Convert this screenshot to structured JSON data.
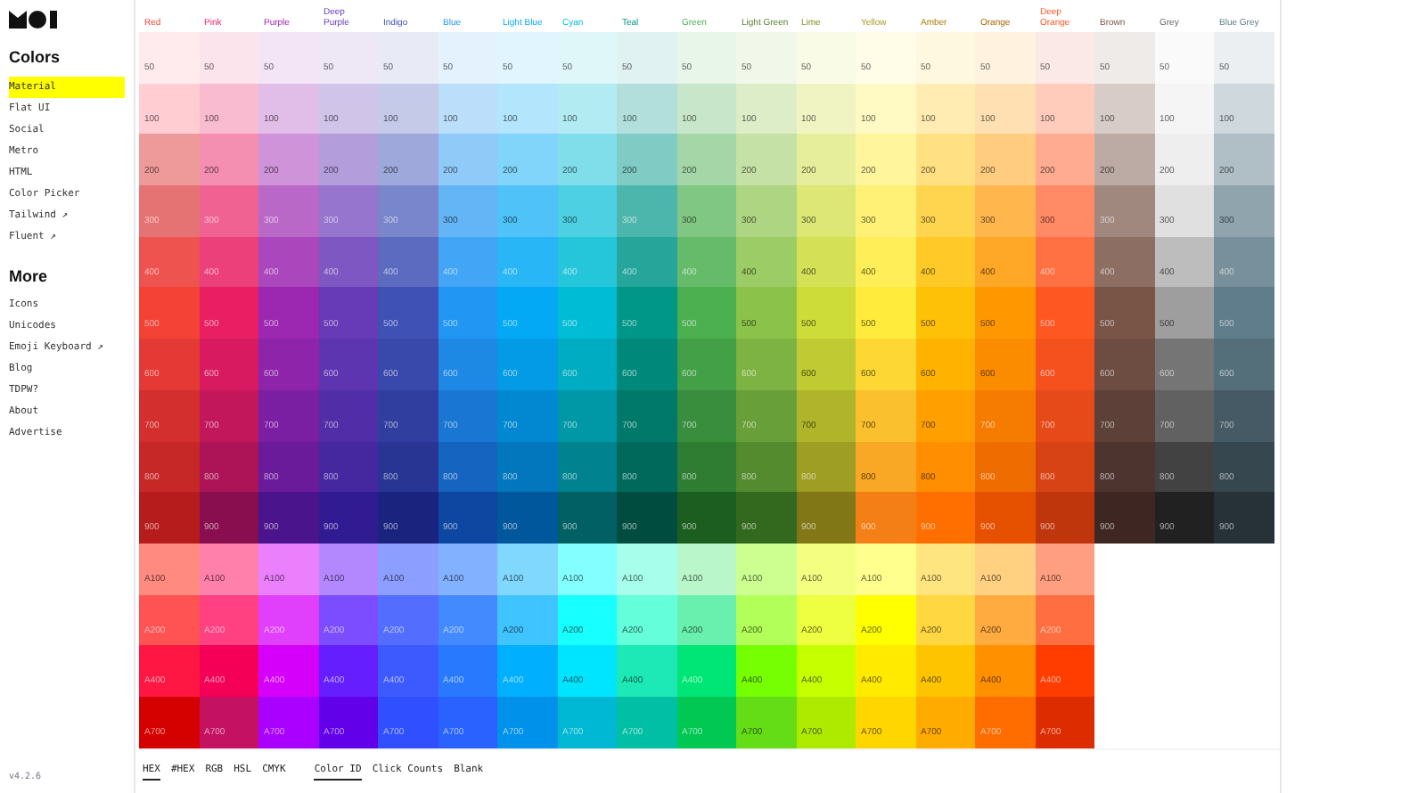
{
  "sidebar": {
    "version": "v4.2.6",
    "sections": [
      {
        "title": "Colors",
        "items": [
          {
            "label": "Material",
            "selected": true
          },
          {
            "label": "Flat UI",
            "selected": false
          },
          {
            "label": "Social",
            "selected": false
          },
          {
            "label": "Metro",
            "selected": false
          },
          {
            "label": "HTML",
            "selected": false
          },
          {
            "label": "Color Picker",
            "selected": false
          },
          {
            "label": "Tailwind ↗",
            "selected": false
          },
          {
            "label": "Fluent ↗",
            "selected": false
          }
        ]
      },
      {
        "title": "More",
        "items": [
          {
            "label": "Icons",
            "selected": false
          },
          {
            "label": "Unicodes",
            "selected": false
          },
          {
            "label": "Emoji Keyboard ↗",
            "selected": false
          },
          {
            "label": "Blog",
            "selected": false
          },
          {
            "label": "TDPW?",
            "selected": false
          },
          {
            "label": "About",
            "selected": false
          },
          {
            "label": "Advertise",
            "selected": false
          }
        ]
      }
    ]
  },
  "columns": [
    {
      "name": "Red",
      "swatches": [
        {
          "label": "50",
          "color": "#ffebee"
        },
        {
          "label": "100",
          "color": "#ffcdd2"
        },
        {
          "label": "200",
          "color": "#ef9a9a"
        },
        {
          "label": "300",
          "color": "#e57373"
        },
        {
          "label": "400",
          "color": "#ef5350"
        },
        {
          "label": "500",
          "color": "#f44336"
        },
        {
          "label": "600",
          "color": "#e53935"
        },
        {
          "label": "700",
          "color": "#d32f2f"
        },
        {
          "label": "800",
          "color": "#c62828"
        },
        {
          "label": "900",
          "color": "#b71c1c"
        },
        {
          "label": "A100",
          "color": "#ff8a80"
        },
        {
          "label": "A200",
          "color": "#ff5252"
        },
        {
          "label": "A400",
          "color": "#ff1744"
        },
        {
          "label": "A700",
          "color": "#d50000"
        }
      ]
    },
    {
      "name": "Pink",
      "swatches": [
        {
          "label": "50",
          "color": "#fce4ec"
        },
        {
          "label": "100",
          "color": "#f8bbd0"
        },
        {
          "label": "200",
          "color": "#f48fb1"
        },
        {
          "label": "300",
          "color": "#f06292"
        },
        {
          "label": "400",
          "color": "#ec407a"
        },
        {
          "label": "500",
          "color": "#e91e63"
        },
        {
          "label": "600",
          "color": "#d81b60"
        },
        {
          "label": "700",
          "color": "#c2185b"
        },
        {
          "label": "800",
          "color": "#ad1457"
        },
        {
          "label": "900",
          "color": "#880e4f"
        },
        {
          "label": "A100",
          "color": "#ff80ab"
        },
        {
          "label": "A200",
          "color": "#ff4081"
        },
        {
          "label": "A400",
          "color": "#f50057"
        },
        {
          "label": "A700",
          "color": "#c51162"
        }
      ]
    },
    {
      "name": "Purple",
      "swatches": [
        {
          "label": "50",
          "color": "#f3e5f5"
        },
        {
          "label": "100",
          "color": "#e1bee7"
        },
        {
          "label": "200",
          "color": "#ce93d8"
        },
        {
          "label": "300",
          "color": "#ba68c8"
        },
        {
          "label": "400",
          "color": "#ab47bc"
        },
        {
          "label": "500",
          "color": "#9c27b0"
        },
        {
          "label": "600",
          "color": "#8e24aa"
        },
        {
          "label": "700",
          "color": "#7b1fa2"
        },
        {
          "label": "800",
          "color": "#6a1b9a"
        },
        {
          "label": "900",
          "color": "#4a148c"
        },
        {
          "label": "A100",
          "color": "#ea80fc"
        },
        {
          "label": "A200",
          "color": "#e040fb"
        },
        {
          "label": "A400",
          "color": "#d500f9"
        },
        {
          "label": "A700",
          "color": "#aa00ff"
        }
      ]
    },
    {
      "name": "Deep Purple",
      "swatches": [
        {
          "label": "50",
          "color": "#ede7f6"
        },
        {
          "label": "100",
          "color": "#d1c4e9"
        },
        {
          "label": "200",
          "color": "#b39ddb"
        },
        {
          "label": "300",
          "color": "#9575cd"
        },
        {
          "label": "400",
          "color": "#7e57c2"
        },
        {
          "label": "500",
          "color": "#673ab7"
        },
        {
          "label": "600",
          "color": "#5e35b1"
        },
        {
          "label": "700",
          "color": "#512da8"
        },
        {
          "label": "800",
          "color": "#4527a0"
        },
        {
          "label": "900",
          "color": "#311b92"
        },
        {
          "label": "A100",
          "color": "#b388ff"
        },
        {
          "label": "A200",
          "color": "#7c4dff"
        },
        {
          "label": "A400",
          "color": "#651fff"
        },
        {
          "label": "A700",
          "color": "#6200ea"
        }
      ]
    },
    {
      "name": "Indigo",
      "swatches": [
        {
          "label": "50",
          "color": "#e8eaf6"
        },
        {
          "label": "100",
          "color": "#c5cae9"
        },
        {
          "label": "200",
          "color": "#9fa8da"
        },
        {
          "label": "300",
          "color": "#7986cb"
        },
        {
          "label": "400",
          "color": "#5c6bc0"
        },
        {
          "label": "500",
          "color": "#3f51b5"
        },
        {
          "label": "600",
          "color": "#3949ab"
        },
        {
          "label": "700",
          "color": "#303f9f"
        },
        {
          "label": "800",
          "color": "#283593"
        },
        {
          "label": "900",
          "color": "#1a237e"
        },
        {
          "label": "A100",
          "color": "#8c9eff"
        },
        {
          "label": "A200",
          "color": "#536dfe"
        },
        {
          "label": "A400",
          "color": "#3d5afe"
        },
        {
          "label": "A700",
          "color": "#304ffe"
        }
      ]
    },
    {
      "name": "Blue",
      "swatches": [
        {
          "label": "50",
          "color": "#e3f2fd"
        },
        {
          "label": "100",
          "color": "#bbdefb"
        },
        {
          "label": "200",
          "color": "#90caf9"
        },
        {
          "label": "300",
          "color": "#64b5f6"
        },
        {
          "label": "400",
          "color": "#42a5f5"
        },
        {
          "label": "500",
          "color": "#2196f3"
        },
        {
          "label": "600",
          "color": "#1e88e5"
        },
        {
          "label": "700",
          "color": "#1976d2"
        },
        {
          "label": "800",
          "color": "#1565c0"
        },
        {
          "label": "900",
          "color": "#0d47a1"
        },
        {
          "label": "A100",
          "color": "#82b1ff"
        },
        {
          "label": "A200",
          "color": "#448aff"
        },
        {
          "label": "A400",
          "color": "#2979ff"
        },
        {
          "label": "A700",
          "color": "#2962ff"
        }
      ]
    },
    {
      "name": "Light Blue",
      "swatches": [
        {
          "label": "50",
          "color": "#e1f5fe"
        },
        {
          "label": "100",
          "color": "#b3e5fc"
        },
        {
          "label": "200",
          "color": "#81d4fa"
        },
        {
          "label": "300",
          "color": "#4fc3f7"
        },
        {
          "label": "400",
          "color": "#29b6f6"
        },
        {
          "label": "500",
          "color": "#03a9f4"
        },
        {
          "label": "600",
          "color": "#039be5"
        },
        {
          "label": "700",
          "color": "#0288d1"
        },
        {
          "label": "800",
          "color": "#0277bd"
        },
        {
          "label": "900",
          "color": "#01579b"
        },
        {
          "label": "A100",
          "color": "#80d8ff"
        },
        {
          "label": "A200",
          "color": "#40c4ff"
        },
        {
          "label": "A400",
          "color": "#00b0ff"
        },
        {
          "label": "A700",
          "color": "#0091ea"
        }
      ]
    },
    {
      "name": "Cyan",
      "swatches": [
        {
          "label": "50",
          "color": "#e0f7fa"
        },
        {
          "label": "100",
          "color": "#b2ebf2"
        },
        {
          "label": "200",
          "color": "#80deea"
        },
        {
          "label": "300",
          "color": "#4dd0e1"
        },
        {
          "label": "400",
          "color": "#26c6da"
        },
        {
          "label": "500",
          "color": "#00bcd4"
        },
        {
          "label": "600",
          "color": "#00acc1"
        },
        {
          "label": "700",
          "color": "#0097a7"
        },
        {
          "label": "800",
          "color": "#00838f"
        },
        {
          "label": "900",
          "color": "#006064"
        },
        {
          "label": "A100",
          "color": "#84ffff"
        },
        {
          "label": "A200",
          "color": "#18ffff"
        },
        {
          "label": "A400",
          "color": "#00e5ff"
        },
        {
          "label": "A700",
          "color": "#00b8d4"
        }
      ]
    },
    {
      "name": "Teal",
      "swatches": [
        {
          "label": "50",
          "color": "#e0f2f1"
        },
        {
          "label": "100",
          "color": "#b2dfdb"
        },
        {
          "label": "200",
          "color": "#80cbc4"
        },
        {
          "label": "300",
          "color": "#4db6ac"
        },
        {
          "label": "400",
          "color": "#26a69a"
        },
        {
          "label": "500",
          "color": "#009688"
        },
        {
          "label": "600",
          "color": "#00897b"
        },
        {
          "label": "700",
          "color": "#00796b"
        },
        {
          "label": "800",
          "color": "#00695c"
        },
        {
          "label": "900",
          "color": "#004d40"
        },
        {
          "label": "A100",
          "color": "#a7ffeb"
        },
        {
          "label": "A200",
          "color": "#64ffda"
        },
        {
          "label": "A400",
          "color": "#1de9b6"
        },
        {
          "label": "A700",
          "color": "#00bfa5"
        }
      ]
    },
    {
      "name": "Green",
      "swatches": [
        {
          "label": "50",
          "color": "#e8f5e9"
        },
        {
          "label": "100",
          "color": "#c8e6c9"
        },
        {
          "label": "200",
          "color": "#a5d6a7"
        },
        {
          "label": "300",
          "color": "#81c784"
        },
        {
          "label": "400",
          "color": "#66bb6a"
        },
        {
          "label": "500",
          "color": "#4caf50"
        },
        {
          "label": "600",
          "color": "#43a047"
        },
        {
          "label": "700",
          "color": "#388e3c"
        },
        {
          "label": "800",
          "color": "#2e7d32"
        },
        {
          "label": "900",
          "color": "#1b5e20"
        },
        {
          "label": "A100",
          "color": "#b9f6ca"
        },
        {
          "label": "A200",
          "color": "#69f0ae"
        },
        {
          "label": "A400",
          "color": "#00e676"
        },
        {
          "label": "A700",
          "color": "#00c853"
        }
      ]
    },
    {
      "name": "Light Green",
      "swatches": [
        {
          "label": "50",
          "color": "#f1f8e9"
        },
        {
          "label": "100",
          "color": "#dcedc8"
        },
        {
          "label": "200",
          "color": "#c5e1a5"
        },
        {
          "label": "300",
          "color": "#aed581"
        },
        {
          "label": "400",
          "color": "#9ccc65"
        },
        {
          "label": "500",
          "color": "#8bc34a"
        },
        {
          "label": "600",
          "color": "#7cb342"
        },
        {
          "label": "700",
          "color": "#689f38"
        },
        {
          "label": "800",
          "color": "#558b2f"
        },
        {
          "label": "900",
          "color": "#33691e"
        },
        {
          "label": "A100",
          "color": "#ccff90"
        },
        {
          "label": "A200",
          "color": "#b2ff59"
        },
        {
          "label": "A400",
          "color": "#76ff03"
        },
        {
          "label": "A700",
          "color": "#64dd17"
        }
      ]
    },
    {
      "name": "Lime",
      "swatches": [
        {
          "label": "50",
          "color": "#f9fbe7"
        },
        {
          "label": "100",
          "color": "#f0f4c3"
        },
        {
          "label": "200",
          "color": "#e6ee9c"
        },
        {
          "label": "300",
          "color": "#dce775"
        },
        {
          "label": "400",
          "color": "#d4e157"
        },
        {
          "label": "500",
          "color": "#cddc39"
        },
        {
          "label": "600",
          "color": "#c0ca33"
        },
        {
          "label": "700",
          "color": "#afb42b"
        },
        {
          "label": "800",
          "color": "#9e9d24"
        },
        {
          "label": "900",
          "color": "#827717"
        },
        {
          "label": "A100",
          "color": "#f4ff81"
        },
        {
          "label": "A200",
          "color": "#eeff41"
        },
        {
          "label": "A400",
          "color": "#c6ff00"
        },
        {
          "label": "A700",
          "color": "#aeea00"
        }
      ]
    },
    {
      "name": "Yellow",
      "swatches": [
        {
          "label": "50",
          "color": "#fffde7"
        },
        {
          "label": "100",
          "color": "#fff9c4"
        },
        {
          "label": "200",
          "color": "#fff59d"
        },
        {
          "label": "300",
          "color": "#fff176"
        },
        {
          "label": "400",
          "color": "#ffee58"
        },
        {
          "label": "500",
          "color": "#ffeb3b"
        },
        {
          "label": "600",
          "color": "#fdd835"
        },
        {
          "label": "700",
          "color": "#fbc02d"
        },
        {
          "label": "800",
          "color": "#f9a825"
        },
        {
          "label": "900",
          "color": "#f57f17"
        },
        {
          "label": "A100",
          "color": "#ffff8d"
        },
        {
          "label": "A200",
          "color": "#ffff00"
        },
        {
          "label": "A400",
          "color": "#ffea00"
        },
        {
          "label": "A700",
          "color": "#ffd600"
        }
      ]
    },
    {
      "name": "Amber",
      "swatches": [
        {
          "label": "50",
          "color": "#fff8e1"
        },
        {
          "label": "100",
          "color": "#ffecb3"
        },
        {
          "label": "200",
          "color": "#ffe082"
        },
        {
          "label": "300",
          "color": "#ffd54f"
        },
        {
          "label": "400",
          "color": "#ffca28"
        },
        {
          "label": "500",
          "color": "#ffc107"
        },
        {
          "label": "600",
          "color": "#ffb300"
        },
        {
          "label": "700",
          "color": "#ffa000"
        },
        {
          "label": "800",
          "color": "#ff8f00"
        },
        {
          "label": "900",
          "color": "#ff6f00"
        },
        {
          "label": "A100",
          "color": "#ffe57f"
        },
        {
          "label": "A200",
          "color": "#ffd740"
        },
        {
          "label": "A400",
          "color": "#ffc400"
        },
        {
          "label": "A700",
          "color": "#ffab00"
        }
      ]
    },
    {
      "name": "Orange",
      "swatches": [
        {
          "label": "50",
          "color": "#fff3e0"
        },
        {
          "label": "100",
          "color": "#ffe0b2"
        },
        {
          "label": "200",
          "color": "#ffcc80"
        },
        {
          "label": "300",
          "color": "#ffb74d"
        },
        {
          "label": "400",
          "color": "#ffa726"
        },
        {
          "label": "500",
          "color": "#ff9800"
        },
        {
          "label": "600",
          "color": "#fb8c00"
        },
        {
          "label": "700",
          "color": "#f57c00"
        },
        {
          "label": "800",
          "color": "#ef6c00"
        },
        {
          "label": "900",
          "color": "#e65100"
        },
        {
          "label": "A100",
          "color": "#ffd180"
        },
        {
          "label": "A200",
          "color": "#ffab40"
        },
        {
          "label": "A400",
          "color": "#ff9100"
        },
        {
          "label": "A700",
          "color": "#ff6d00"
        }
      ]
    },
    {
      "name": "Deep Orange",
      "swatches": [
        {
          "label": "50",
          "color": "#fbe9e7"
        },
        {
          "label": "100",
          "color": "#ffccbc"
        },
        {
          "label": "200",
          "color": "#ffab91"
        },
        {
          "label": "300",
          "color": "#ff8a65"
        },
        {
          "label": "400",
          "color": "#ff7043"
        },
        {
          "label": "500",
          "color": "#ff5722"
        },
        {
          "label": "600",
          "color": "#f4511e"
        },
        {
          "label": "700",
          "color": "#e64a19"
        },
        {
          "label": "800",
          "color": "#d84315"
        },
        {
          "label": "900",
          "color": "#bf360c"
        },
        {
          "label": "A100",
          "color": "#ff9e80"
        },
        {
          "label": "A200",
          "color": "#ff6e40"
        },
        {
          "label": "A400",
          "color": "#ff3d00"
        },
        {
          "label": "A700",
          "color": "#dd2c00"
        }
      ]
    },
    {
      "name": "Brown",
      "swatches": [
        {
          "label": "50",
          "color": "#efebe9"
        },
        {
          "label": "100",
          "color": "#d7ccc8"
        },
        {
          "label": "200",
          "color": "#bcaaa4"
        },
        {
          "label": "300",
          "color": "#a1887f"
        },
        {
          "label": "400",
          "color": "#8d6e63"
        },
        {
          "label": "500",
          "color": "#795548"
        },
        {
          "label": "600",
          "color": "#6d4c41"
        },
        {
          "label": "700",
          "color": "#5d4037"
        },
        {
          "label": "800",
          "color": "#4e342e"
        },
        {
          "label": "900",
          "color": "#3e2723"
        }
      ]
    },
    {
      "name": "Grey",
      "swatches": [
        {
          "label": "50",
          "color": "#fafafa"
        },
        {
          "label": "100",
          "color": "#f5f5f5"
        },
        {
          "label": "200",
          "color": "#eeeeee"
        },
        {
          "label": "300",
          "color": "#e0e0e0"
        },
        {
          "label": "400",
          "color": "#bdbdbd"
        },
        {
          "label": "500",
          "color": "#9e9e9e"
        },
        {
          "label": "600",
          "color": "#757575"
        },
        {
          "label": "700",
          "color": "#616161"
        },
        {
          "label": "800",
          "color": "#424242"
        },
        {
          "label": "900",
          "color": "#212121"
        }
      ]
    },
    {
      "name": "Blue Grey",
      "swatches": [
        {
          "label": "50",
          "color": "#eceff1"
        },
        {
          "label": "100",
          "color": "#cfd8dc"
        },
        {
          "label": "200",
          "color": "#b0bec5"
        },
        {
          "label": "300",
          "color": "#90a4ae"
        },
        {
          "label": "400",
          "color": "#78909c"
        },
        {
          "label": "500",
          "color": "#607d8b"
        },
        {
          "label": "600",
          "color": "#546e7a"
        },
        {
          "label": "700",
          "color": "#455a64"
        },
        {
          "label": "800",
          "color": "#37474f"
        },
        {
          "label": "900",
          "color": "#263238"
        }
      ]
    }
  ],
  "footer": {
    "groups": [
      [
        {
          "label": "HEX",
          "selected": true
        },
        {
          "label": "#HEX",
          "selected": false
        },
        {
          "label": "RGB",
          "selected": false
        },
        {
          "label": "HSL",
          "selected": false
        },
        {
          "label": "CMYK",
          "selected": false
        }
      ],
      [
        {
          "label": "Color ID",
          "selected": true
        },
        {
          "label": "Click Counts",
          "selected": false
        },
        {
          "label": "Blank",
          "selected": false
        }
      ]
    ]
  }
}
